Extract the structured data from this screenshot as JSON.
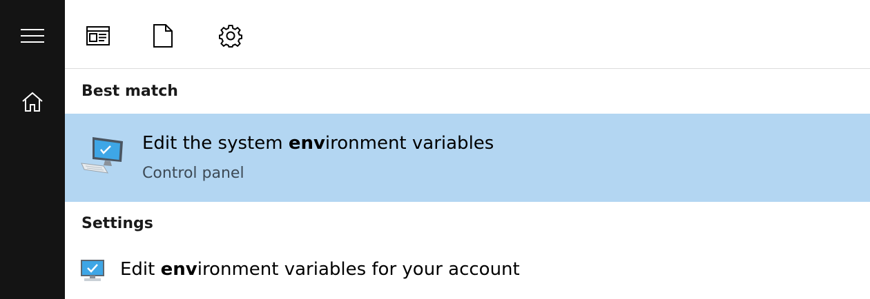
{
  "rail": {
    "menu_icon": "hamburger-menu-icon",
    "home_icon": "home-icon"
  },
  "toolbar": {
    "apps_icon": "apps-icon",
    "documents_icon": "document-icon",
    "settings_icon": "gear-icon"
  },
  "sections": {
    "best_match": "Best match",
    "settings": "Settings"
  },
  "best_match": {
    "title_pre": "Edit the system ",
    "title_match": "env",
    "title_post": "ironment variables",
    "subtitle": "Control panel",
    "icon": "system-properties-computer-icon"
  },
  "settings_item": {
    "title_pre": "Edit ",
    "title_match": "env",
    "title_post": "ironment variables for your account",
    "icon": "monitor-check-icon"
  },
  "colors": {
    "rail_bg": "#141414",
    "highlight_bg": "#b3d6f2",
    "divider": "#dcdcdc"
  }
}
